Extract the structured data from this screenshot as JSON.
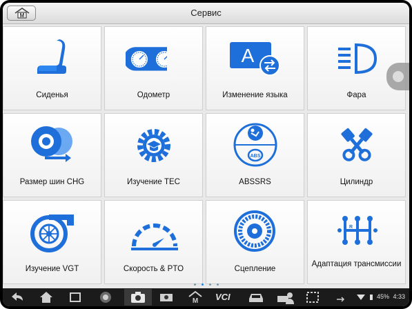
{
  "header": {
    "title": "Сервис"
  },
  "tiles": [
    {
      "label": "Сиденья",
      "icon": "seat-icon"
    },
    {
      "label": "Одометр",
      "icon": "odometer-icon"
    },
    {
      "label": "Изменение языка",
      "icon": "language-change-icon"
    },
    {
      "label": "Фара",
      "icon": "headlight-icon"
    },
    {
      "label": "Размер шин CHG",
      "icon": "tire-size-icon"
    },
    {
      "label": "Изучение TEC",
      "icon": "tec-learning-icon"
    },
    {
      "label": "ABSSRS",
      "icon": "abs-srs-icon"
    },
    {
      "label": "Цилиндр",
      "icon": "cylinder-icon"
    },
    {
      "label": "Изучение VGT",
      "icon": "turbo-icon"
    },
    {
      "label": "Скорость & PTO",
      "icon": "speed-pto-icon"
    },
    {
      "label": "Сцепление",
      "icon": "clutch-icon"
    },
    {
      "label": "Адаптация трансмиссии",
      "icon": "transmission-icon"
    }
  ],
  "pager": {
    "pages": 4,
    "current": 2
  },
  "taskbar": {
    "vcl_label": "VCI",
    "battery": "45%",
    "time": "4:33"
  },
  "colors": {
    "accent": "#1e6fd9",
    "tile_bg": "#ffffff",
    "taskbar": "#1b1b1b"
  }
}
